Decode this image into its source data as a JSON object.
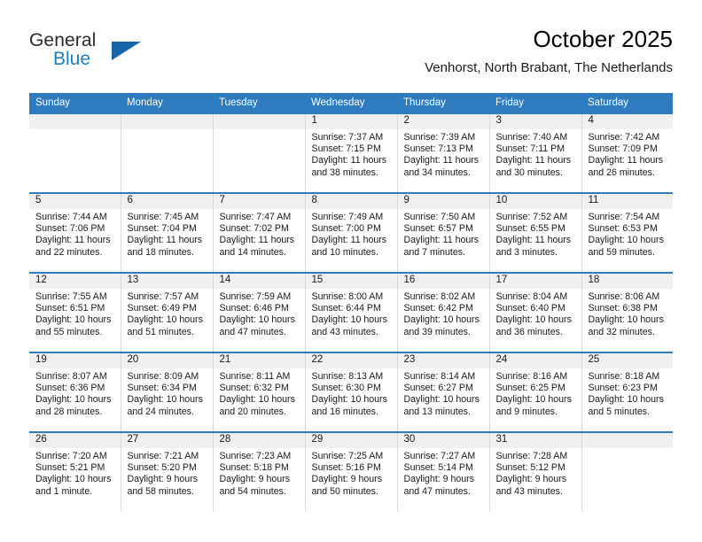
{
  "logo": {
    "word1": "General",
    "word2": "Blue",
    "triangle_color": "#1565a8",
    "blue_color": "#1c7fc4"
  },
  "header": {
    "title": "October 2025",
    "subtitle": "Venhorst, North Brabant, The Netherlands"
  },
  "theme": {
    "header_blue": "#2e7cbf",
    "daynum_band": "#f0f0f0",
    "grid_line": "#d9d9d9"
  },
  "weekdays": [
    "Sunday",
    "Monday",
    "Tuesday",
    "Wednesday",
    "Thursday",
    "Friday",
    "Saturday"
  ],
  "labels": {
    "sunrise_prefix": "Sunrise:",
    "sunset_prefix": "Sunset:",
    "daylight_prefix": "Daylight:"
  },
  "weeks": [
    [
      {
        "day": ""
      },
      {
        "day": ""
      },
      {
        "day": ""
      },
      {
        "day": "1",
        "sunrise": "Sunrise: 7:37 AM",
        "sunset": "Sunset: 7:15 PM",
        "daylight_1": "Daylight: 11 hours",
        "daylight_2": "and 38 minutes."
      },
      {
        "day": "2",
        "sunrise": "Sunrise: 7:39 AM",
        "sunset": "Sunset: 7:13 PM",
        "daylight_1": "Daylight: 11 hours",
        "daylight_2": "and 34 minutes."
      },
      {
        "day": "3",
        "sunrise": "Sunrise: 7:40 AM",
        "sunset": "Sunset: 7:11 PM",
        "daylight_1": "Daylight: 11 hours",
        "daylight_2": "and 30 minutes."
      },
      {
        "day": "4",
        "sunrise": "Sunrise: 7:42 AM",
        "sunset": "Sunset: 7:09 PM",
        "daylight_1": "Daylight: 11 hours",
        "daylight_2": "and 26 minutes."
      }
    ],
    [
      {
        "day": "5",
        "sunrise": "Sunrise: 7:44 AM",
        "sunset": "Sunset: 7:06 PM",
        "daylight_1": "Daylight: 11 hours",
        "daylight_2": "and 22 minutes."
      },
      {
        "day": "6",
        "sunrise": "Sunrise: 7:45 AM",
        "sunset": "Sunset: 7:04 PM",
        "daylight_1": "Daylight: 11 hours",
        "daylight_2": "and 18 minutes."
      },
      {
        "day": "7",
        "sunrise": "Sunrise: 7:47 AM",
        "sunset": "Sunset: 7:02 PM",
        "daylight_1": "Daylight: 11 hours",
        "daylight_2": "and 14 minutes."
      },
      {
        "day": "8",
        "sunrise": "Sunrise: 7:49 AM",
        "sunset": "Sunset: 7:00 PM",
        "daylight_1": "Daylight: 11 hours",
        "daylight_2": "and 10 minutes."
      },
      {
        "day": "9",
        "sunrise": "Sunrise: 7:50 AM",
        "sunset": "Sunset: 6:57 PM",
        "daylight_1": "Daylight: 11 hours",
        "daylight_2": "and 7 minutes."
      },
      {
        "day": "10",
        "sunrise": "Sunrise: 7:52 AM",
        "sunset": "Sunset: 6:55 PM",
        "daylight_1": "Daylight: 11 hours",
        "daylight_2": "and 3 minutes."
      },
      {
        "day": "11",
        "sunrise": "Sunrise: 7:54 AM",
        "sunset": "Sunset: 6:53 PM",
        "daylight_1": "Daylight: 10 hours",
        "daylight_2": "and 59 minutes."
      }
    ],
    [
      {
        "day": "12",
        "sunrise": "Sunrise: 7:55 AM",
        "sunset": "Sunset: 6:51 PM",
        "daylight_1": "Daylight: 10 hours",
        "daylight_2": "and 55 minutes."
      },
      {
        "day": "13",
        "sunrise": "Sunrise: 7:57 AM",
        "sunset": "Sunset: 6:49 PM",
        "daylight_1": "Daylight: 10 hours",
        "daylight_2": "and 51 minutes."
      },
      {
        "day": "14",
        "sunrise": "Sunrise: 7:59 AM",
        "sunset": "Sunset: 6:46 PM",
        "daylight_1": "Daylight: 10 hours",
        "daylight_2": "and 47 minutes."
      },
      {
        "day": "15",
        "sunrise": "Sunrise: 8:00 AM",
        "sunset": "Sunset: 6:44 PM",
        "daylight_1": "Daylight: 10 hours",
        "daylight_2": "and 43 minutes."
      },
      {
        "day": "16",
        "sunrise": "Sunrise: 8:02 AM",
        "sunset": "Sunset: 6:42 PM",
        "daylight_1": "Daylight: 10 hours",
        "daylight_2": "and 39 minutes."
      },
      {
        "day": "17",
        "sunrise": "Sunrise: 8:04 AM",
        "sunset": "Sunset: 6:40 PM",
        "daylight_1": "Daylight: 10 hours",
        "daylight_2": "and 36 minutes."
      },
      {
        "day": "18",
        "sunrise": "Sunrise: 8:06 AM",
        "sunset": "Sunset: 6:38 PM",
        "daylight_1": "Daylight: 10 hours",
        "daylight_2": "and 32 minutes."
      }
    ],
    [
      {
        "day": "19",
        "sunrise": "Sunrise: 8:07 AM",
        "sunset": "Sunset: 6:36 PM",
        "daylight_1": "Daylight: 10 hours",
        "daylight_2": "and 28 minutes."
      },
      {
        "day": "20",
        "sunrise": "Sunrise: 8:09 AM",
        "sunset": "Sunset: 6:34 PM",
        "daylight_1": "Daylight: 10 hours",
        "daylight_2": "and 24 minutes."
      },
      {
        "day": "21",
        "sunrise": "Sunrise: 8:11 AM",
        "sunset": "Sunset: 6:32 PM",
        "daylight_1": "Daylight: 10 hours",
        "daylight_2": "and 20 minutes."
      },
      {
        "day": "22",
        "sunrise": "Sunrise: 8:13 AM",
        "sunset": "Sunset: 6:30 PM",
        "daylight_1": "Daylight: 10 hours",
        "daylight_2": "and 16 minutes."
      },
      {
        "day": "23",
        "sunrise": "Sunrise: 8:14 AM",
        "sunset": "Sunset: 6:27 PM",
        "daylight_1": "Daylight: 10 hours",
        "daylight_2": "and 13 minutes."
      },
      {
        "day": "24",
        "sunrise": "Sunrise: 8:16 AM",
        "sunset": "Sunset: 6:25 PM",
        "daylight_1": "Daylight: 10 hours",
        "daylight_2": "and 9 minutes."
      },
      {
        "day": "25",
        "sunrise": "Sunrise: 8:18 AM",
        "sunset": "Sunset: 6:23 PM",
        "daylight_1": "Daylight: 10 hours",
        "daylight_2": "and 5 minutes."
      }
    ],
    [
      {
        "day": "26",
        "sunrise": "Sunrise: 7:20 AM",
        "sunset": "Sunset: 5:21 PM",
        "daylight_1": "Daylight: 10 hours",
        "daylight_2": "and 1 minute."
      },
      {
        "day": "27",
        "sunrise": "Sunrise: 7:21 AM",
        "sunset": "Sunset: 5:20 PM",
        "daylight_1": "Daylight: 9 hours",
        "daylight_2": "and 58 minutes."
      },
      {
        "day": "28",
        "sunrise": "Sunrise: 7:23 AM",
        "sunset": "Sunset: 5:18 PM",
        "daylight_1": "Daylight: 9 hours",
        "daylight_2": "and 54 minutes."
      },
      {
        "day": "29",
        "sunrise": "Sunrise: 7:25 AM",
        "sunset": "Sunset: 5:16 PM",
        "daylight_1": "Daylight: 9 hours",
        "daylight_2": "and 50 minutes."
      },
      {
        "day": "30",
        "sunrise": "Sunrise: 7:27 AM",
        "sunset": "Sunset: 5:14 PM",
        "daylight_1": "Daylight: 9 hours",
        "daylight_2": "and 47 minutes."
      },
      {
        "day": "31",
        "sunrise": "Sunrise: 7:28 AM",
        "sunset": "Sunset: 5:12 PM",
        "daylight_1": "Daylight: 9 hours",
        "daylight_2": "and 43 minutes."
      },
      {
        "day": ""
      }
    ]
  ]
}
